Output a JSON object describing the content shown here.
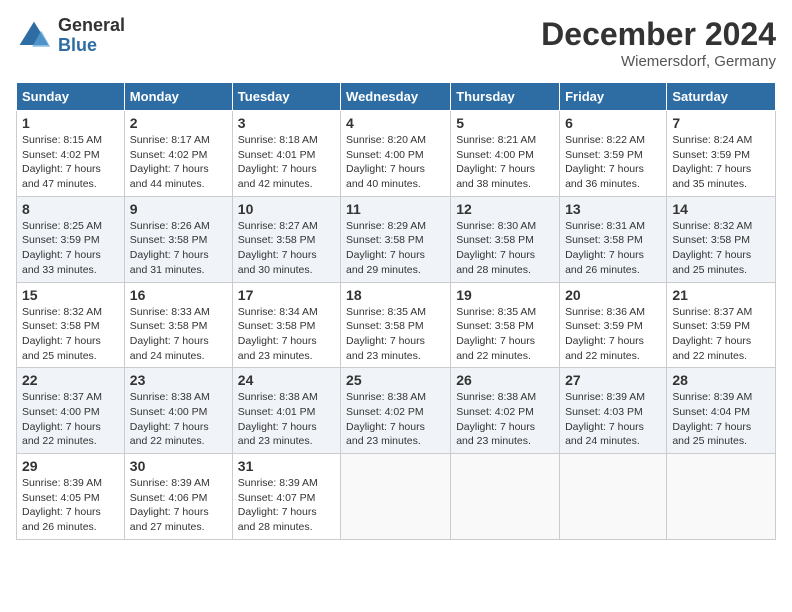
{
  "header": {
    "logo_general": "General",
    "logo_blue": "Blue",
    "month_title": "December 2024",
    "location": "Wiemersdorf, Germany"
  },
  "days_of_week": [
    "Sunday",
    "Monday",
    "Tuesday",
    "Wednesday",
    "Thursday",
    "Friday",
    "Saturday"
  ],
  "weeks": [
    [
      {
        "day": "1",
        "sunrise": "8:15 AM",
        "sunset": "4:02 PM",
        "daylight": "7 hours and 47 minutes."
      },
      {
        "day": "2",
        "sunrise": "8:17 AM",
        "sunset": "4:02 PM",
        "daylight": "7 hours and 44 minutes."
      },
      {
        "day": "3",
        "sunrise": "8:18 AM",
        "sunset": "4:01 PM",
        "daylight": "7 hours and 42 minutes."
      },
      {
        "day": "4",
        "sunrise": "8:20 AM",
        "sunset": "4:00 PM",
        "daylight": "7 hours and 40 minutes."
      },
      {
        "day": "5",
        "sunrise": "8:21 AM",
        "sunset": "4:00 PM",
        "daylight": "7 hours and 38 minutes."
      },
      {
        "day": "6",
        "sunrise": "8:22 AM",
        "sunset": "3:59 PM",
        "daylight": "7 hours and 36 minutes."
      },
      {
        "day": "7",
        "sunrise": "8:24 AM",
        "sunset": "3:59 PM",
        "daylight": "7 hours and 35 minutes."
      }
    ],
    [
      {
        "day": "8",
        "sunrise": "8:25 AM",
        "sunset": "3:59 PM",
        "daylight": "7 hours and 33 minutes."
      },
      {
        "day": "9",
        "sunrise": "8:26 AM",
        "sunset": "3:58 PM",
        "daylight": "7 hours and 31 minutes."
      },
      {
        "day": "10",
        "sunrise": "8:27 AM",
        "sunset": "3:58 PM",
        "daylight": "7 hours and 30 minutes."
      },
      {
        "day": "11",
        "sunrise": "8:29 AM",
        "sunset": "3:58 PM",
        "daylight": "7 hours and 29 minutes."
      },
      {
        "day": "12",
        "sunrise": "8:30 AM",
        "sunset": "3:58 PM",
        "daylight": "7 hours and 28 minutes."
      },
      {
        "day": "13",
        "sunrise": "8:31 AM",
        "sunset": "3:58 PM",
        "daylight": "7 hours and 26 minutes."
      },
      {
        "day": "14",
        "sunrise": "8:32 AM",
        "sunset": "3:58 PM",
        "daylight": "7 hours and 25 minutes."
      }
    ],
    [
      {
        "day": "15",
        "sunrise": "8:32 AM",
        "sunset": "3:58 PM",
        "daylight": "7 hours and 25 minutes."
      },
      {
        "day": "16",
        "sunrise": "8:33 AM",
        "sunset": "3:58 PM",
        "daylight": "7 hours and 24 minutes."
      },
      {
        "day": "17",
        "sunrise": "8:34 AM",
        "sunset": "3:58 PM",
        "daylight": "7 hours and 23 minutes."
      },
      {
        "day": "18",
        "sunrise": "8:35 AM",
        "sunset": "3:58 PM",
        "daylight": "7 hours and 23 minutes."
      },
      {
        "day": "19",
        "sunrise": "8:35 AM",
        "sunset": "3:58 PM",
        "daylight": "7 hours and 22 minutes."
      },
      {
        "day": "20",
        "sunrise": "8:36 AM",
        "sunset": "3:59 PM",
        "daylight": "7 hours and 22 minutes."
      },
      {
        "day": "21",
        "sunrise": "8:37 AM",
        "sunset": "3:59 PM",
        "daylight": "7 hours and 22 minutes."
      }
    ],
    [
      {
        "day": "22",
        "sunrise": "8:37 AM",
        "sunset": "4:00 PM",
        "daylight": "7 hours and 22 minutes."
      },
      {
        "day": "23",
        "sunrise": "8:38 AM",
        "sunset": "4:00 PM",
        "daylight": "7 hours and 22 minutes."
      },
      {
        "day": "24",
        "sunrise": "8:38 AM",
        "sunset": "4:01 PM",
        "daylight": "7 hours and 23 minutes."
      },
      {
        "day": "25",
        "sunrise": "8:38 AM",
        "sunset": "4:02 PM",
        "daylight": "7 hours and 23 minutes."
      },
      {
        "day": "26",
        "sunrise": "8:38 AM",
        "sunset": "4:02 PM",
        "daylight": "7 hours and 23 minutes."
      },
      {
        "day": "27",
        "sunrise": "8:39 AM",
        "sunset": "4:03 PM",
        "daylight": "7 hours and 24 minutes."
      },
      {
        "day": "28",
        "sunrise": "8:39 AM",
        "sunset": "4:04 PM",
        "daylight": "7 hours and 25 minutes."
      }
    ],
    [
      {
        "day": "29",
        "sunrise": "8:39 AM",
        "sunset": "4:05 PM",
        "daylight": "7 hours and 26 minutes."
      },
      {
        "day": "30",
        "sunrise": "8:39 AM",
        "sunset": "4:06 PM",
        "daylight": "7 hours and 27 minutes."
      },
      {
        "day": "31",
        "sunrise": "8:39 AM",
        "sunset": "4:07 PM",
        "daylight": "7 hours and 28 minutes."
      },
      null,
      null,
      null,
      null
    ]
  ],
  "labels": {
    "sunrise": "Sunrise:",
    "sunset": "Sunset:",
    "daylight": "Daylight:"
  }
}
